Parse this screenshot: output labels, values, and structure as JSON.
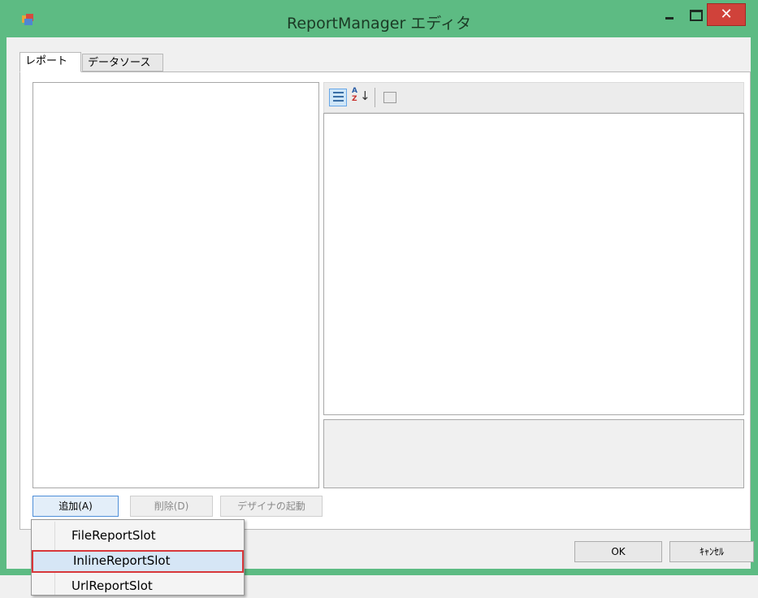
{
  "window": {
    "title": "ReportManager エディタ",
    "controls": {
      "minimize": "–",
      "maximize": "□",
      "close": "✕"
    },
    "colors": {
      "frame": "#5dbb83",
      "close": "#d0423a",
      "highlight": "#d8373a"
    }
  },
  "tabs": [
    {
      "label": "レポート",
      "selected": true
    },
    {
      "label": "データソース",
      "selected": false
    }
  ],
  "buttons": {
    "add": "追加(A)",
    "delete": "削除(D)",
    "designer": "デザイナの起動",
    "ok": "OK",
    "cancel": "ｷｬﾝｾﾙ"
  },
  "property_grid": {
    "toolbar": [
      "categorized-icon",
      "alphabetical-icon",
      "property-pages-icon"
    ]
  },
  "menu": {
    "items": [
      "FileReportSlot",
      "InlineReportSlot",
      "UrlReportSlot"
    ],
    "highlighted": "InlineReportSlot"
  }
}
